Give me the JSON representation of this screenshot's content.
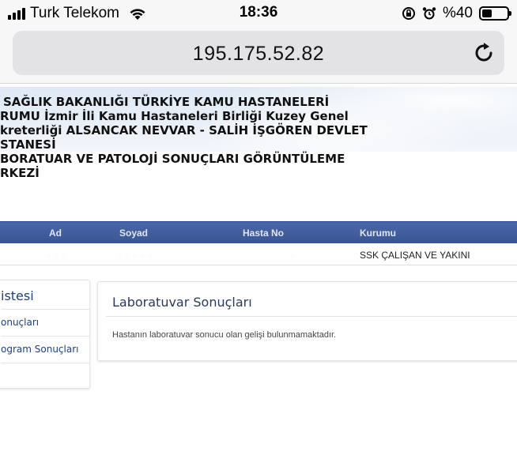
{
  "status_bar": {
    "carrier": "Turk Telekom",
    "time": "18:36",
    "battery_percent": "%40",
    "battery_level": 0.4
  },
  "browser": {
    "url": "195.175.52.82"
  },
  "header": {
    "title_lines": [
      "SAĞLIK BAKANLIĞI TÜRKİYE KAMU HASTANELERİ",
      "RUMU İzmir İli Kamu Hastaneleri Birliği Kuzey Genel",
      "kreterliği ALSANCAK NEVVAR - SALİH İŞGÖREN DEVLET",
      "STANESİ",
      "BORATUAR VE PATOLOJİ SONUÇLARI GÖRÜNTÜLEME",
      "RKEZİ"
    ]
  },
  "patient_table": {
    "columns": [
      "Ad",
      "Soyad",
      "Hasta No",
      "Kurumu"
    ],
    "row": {
      "ad": "",
      "soyad": "",
      "hasta_no": "",
      "kurumu": "SSK ÇALIŞAN VE YAKINI"
    }
  },
  "left_panel": {
    "title": "istesi",
    "items": [
      "onuçları",
      "ogram Sonuçları"
    ]
  },
  "right_panel": {
    "title": "Laboratuvar Sonuçları",
    "message": "Hastanın laboratuvar sonucu olan gelişi bulunmamaktadır."
  },
  "colors": {
    "header_blue": "#3a5593",
    "link_blue": "#1f3f7a"
  }
}
